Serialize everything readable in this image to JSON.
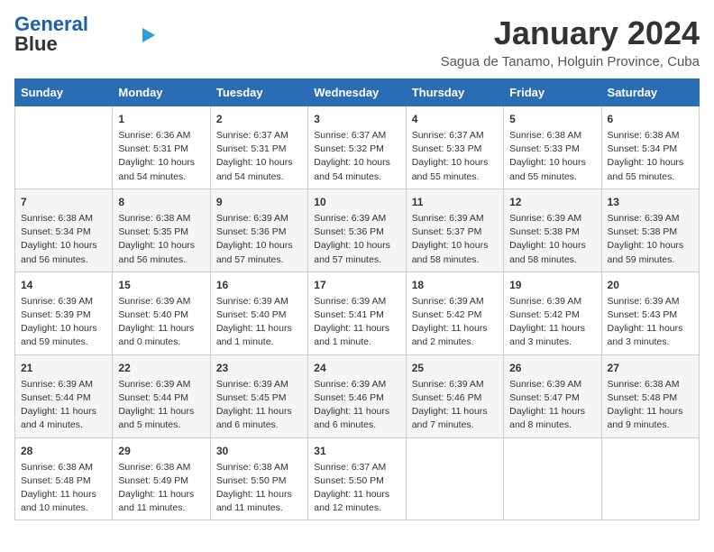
{
  "logo": {
    "line1": "General",
    "line2": "Blue"
  },
  "title": "January 2024",
  "subtitle": "Sagua de Tanamo, Holguin Province, Cuba",
  "days_header": [
    "Sunday",
    "Monday",
    "Tuesday",
    "Wednesday",
    "Thursday",
    "Friday",
    "Saturday"
  ],
  "weeks": [
    [
      {
        "num": "",
        "text": ""
      },
      {
        "num": "1",
        "text": "Sunrise: 6:36 AM\nSunset: 5:31 PM\nDaylight: 10 hours\nand 54 minutes."
      },
      {
        "num": "2",
        "text": "Sunrise: 6:37 AM\nSunset: 5:31 PM\nDaylight: 10 hours\nand 54 minutes."
      },
      {
        "num": "3",
        "text": "Sunrise: 6:37 AM\nSunset: 5:32 PM\nDaylight: 10 hours\nand 54 minutes."
      },
      {
        "num": "4",
        "text": "Sunrise: 6:37 AM\nSunset: 5:33 PM\nDaylight: 10 hours\nand 55 minutes."
      },
      {
        "num": "5",
        "text": "Sunrise: 6:38 AM\nSunset: 5:33 PM\nDaylight: 10 hours\nand 55 minutes."
      },
      {
        "num": "6",
        "text": "Sunrise: 6:38 AM\nSunset: 5:34 PM\nDaylight: 10 hours\nand 55 minutes."
      }
    ],
    [
      {
        "num": "7",
        "text": "Sunrise: 6:38 AM\nSunset: 5:34 PM\nDaylight: 10 hours\nand 56 minutes."
      },
      {
        "num": "8",
        "text": "Sunrise: 6:38 AM\nSunset: 5:35 PM\nDaylight: 10 hours\nand 56 minutes."
      },
      {
        "num": "9",
        "text": "Sunrise: 6:39 AM\nSunset: 5:36 PM\nDaylight: 10 hours\nand 57 minutes."
      },
      {
        "num": "10",
        "text": "Sunrise: 6:39 AM\nSunset: 5:36 PM\nDaylight: 10 hours\nand 57 minutes."
      },
      {
        "num": "11",
        "text": "Sunrise: 6:39 AM\nSunset: 5:37 PM\nDaylight: 10 hours\nand 58 minutes."
      },
      {
        "num": "12",
        "text": "Sunrise: 6:39 AM\nSunset: 5:38 PM\nDaylight: 10 hours\nand 58 minutes."
      },
      {
        "num": "13",
        "text": "Sunrise: 6:39 AM\nSunset: 5:38 PM\nDaylight: 10 hours\nand 59 minutes."
      }
    ],
    [
      {
        "num": "14",
        "text": "Sunrise: 6:39 AM\nSunset: 5:39 PM\nDaylight: 10 hours\nand 59 minutes."
      },
      {
        "num": "15",
        "text": "Sunrise: 6:39 AM\nSunset: 5:40 PM\nDaylight: 11 hours\nand 0 minutes."
      },
      {
        "num": "16",
        "text": "Sunrise: 6:39 AM\nSunset: 5:40 PM\nDaylight: 11 hours\nand 1 minute."
      },
      {
        "num": "17",
        "text": "Sunrise: 6:39 AM\nSunset: 5:41 PM\nDaylight: 11 hours\nand 1 minute."
      },
      {
        "num": "18",
        "text": "Sunrise: 6:39 AM\nSunset: 5:42 PM\nDaylight: 11 hours\nand 2 minutes."
      },
      {
        "num": "19",
        "text": "Sunrise: 6:39 AM\nSunset: 5:42 PM\nDaylight: 11 hours\nand 3 minutes."
      },
      {
        "num": "20",
        "text": "Sunrise: 6:39 AM\nSunset: 5:43 PM\nDaylight: 11 hours\nand 3 minutes."
      }
    ],
    [
      {
        "num": "21",
        "text": "Sunrise: 6:39 AM\nSunset: 5:44 PM\nDaylight: 11 hours\nand 4 minutes."
      },
      {
        "num": "22",
        "text": "Sunrise: 6:39 AM\nSunset: 5:44 PM\nDaylight: 11 hours\nand 5 minutes."
      },
      {
        "num": "23",
        "text": "Sunrise: 6:39 AM\nSunset: 5:45 PM\nDaylight: 11 hours\nand 6 minutes."
      },
      {
        "num": "24",
        "text": "Sunrise: 6:39 AM\nSunset: 5:46 PM\nDaylight: 11 hours\nand 6 minutes."
      },
      {
        "num": "25",
        "text": "Sunrise: 6:39 AM\nSunset: 5:46 PM\nDaylight: 11 hours\nand 7 minutes."
      },
      {
        "num": "26",
        "text": "Sunrise: 6:39 AM\nSunset: 5:47 PM\nDaylight: 11 hours\nand 8 minutes."
      },
      {
        "num": "27",
        "text": "Sunrise: 6:38 AM\nSunset: 5:48 PM\nDaylight: 11 hours\nand 9 minutes."
      }
    ],
    [
      {
        "num": "28",
        "text": "Sunrise: 6:38 AM\nSunset: 5:48 PM\nDaylight: 11 hours\nand 10 minutes."
      },
      {
        "num": "29",
        "text": "Sunrise: 6:38 AM\nSunset: 5:49 PM\nDaylight: 11 hours\nand 11 minutes."
      },
      {
        "num": "30",
        "text": "Sunrise: 6:38 AM\nSunset: 5:50 PM\nDaylight: 11 hours\nand 11 minutes."
      },
      {
        "num": "31",
        "text": "Sunrise: 6:37 AM\nSunset: 5:50 PM\nDaylight: 11 hours\nand 12 minutes."
      },
      {
        "num": "",
        "text": ""
      },
      {
        "num": "",
        "text": ""
      },
      {
        "num": "",
        "text": ""
      }
    ]
  ]
}
